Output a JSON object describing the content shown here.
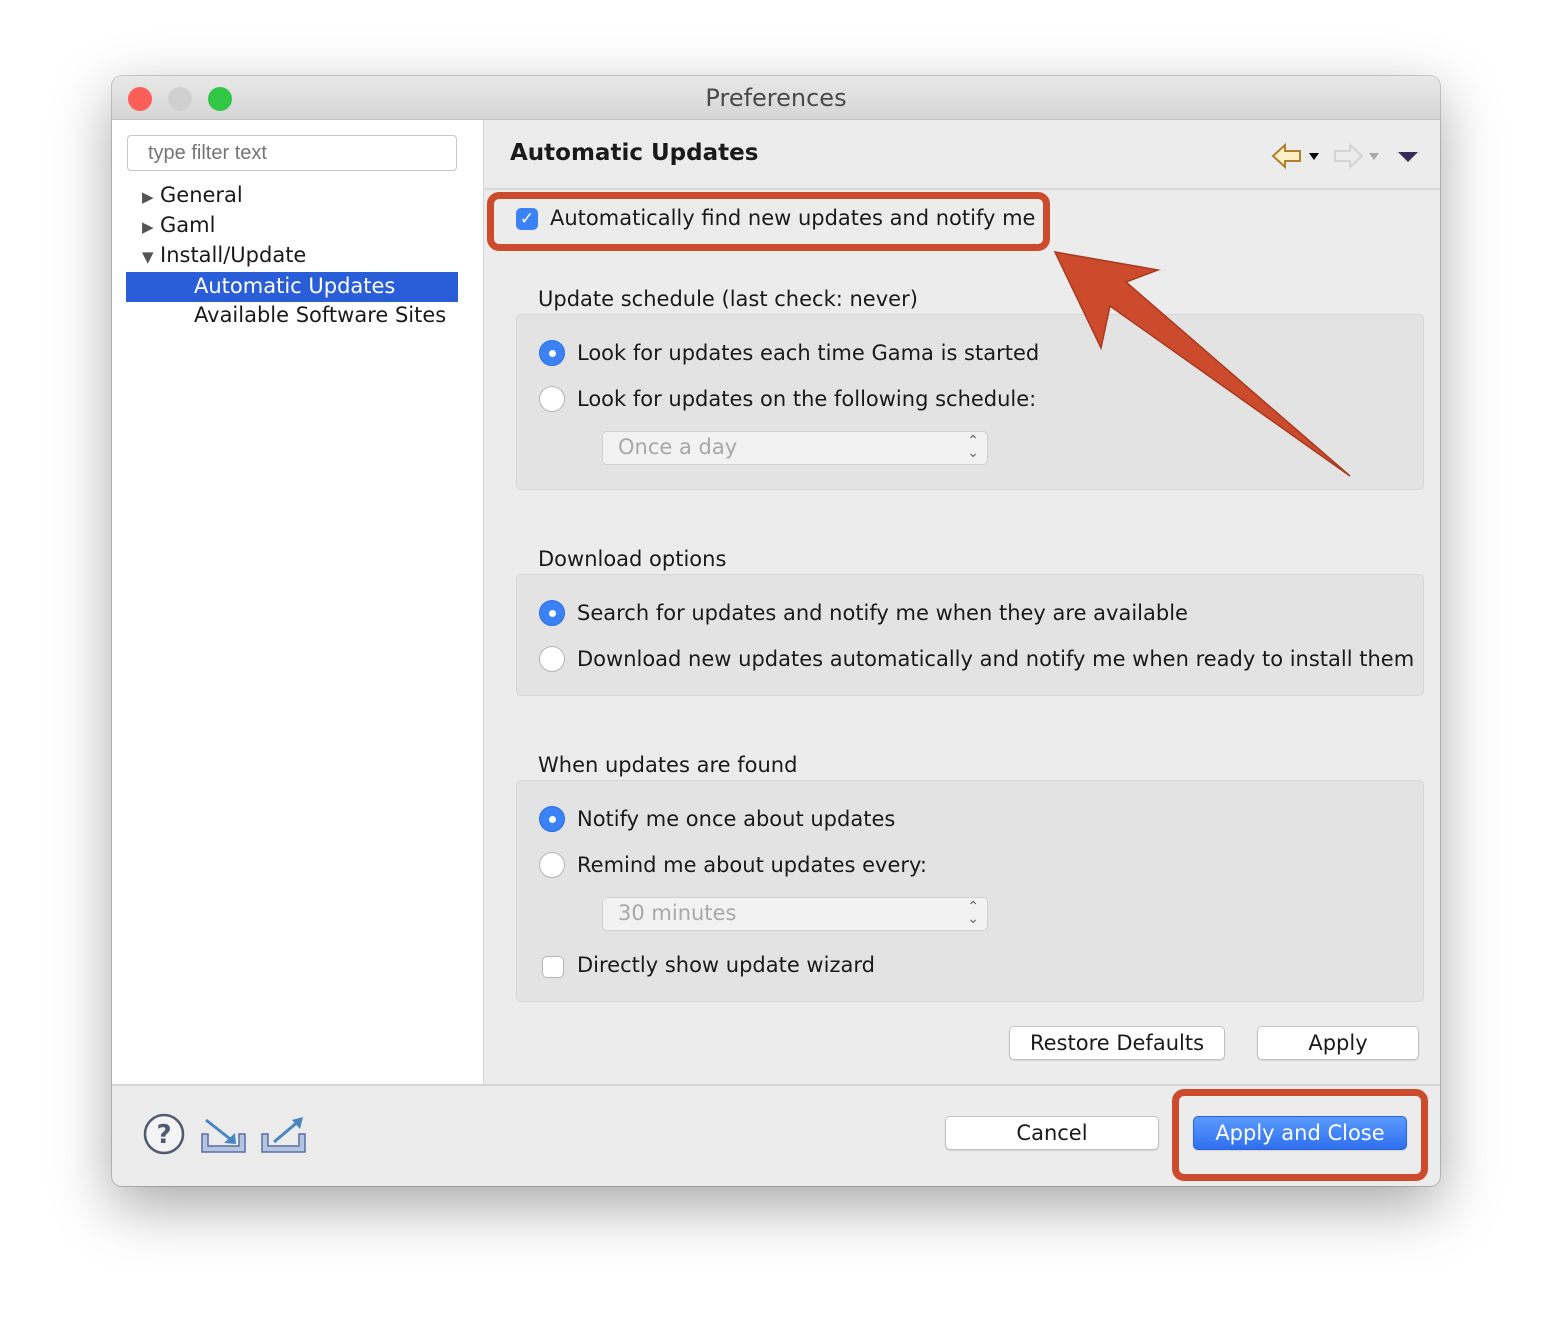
{
  "window": {
    "title": "Preferences",
    "traffic_colors": [
      "#fc5f57",
      "#d0d0d0",
      "#33c748"
    ]
  },
  "sidebar": {
    "filter_placeholder": "type filter text",
    "items": [
      {
        "label": "General",
        "expanded": false
      },
      {
        "label": "Gaml",
        "expanded": false
      },
      {
        "label": "Install/Update",
        "expanded": true
      },
      {
        "label": "Automatic Updates",
        "selected": true
      },
      {
        "label": "Available Software Sites"
      }
    ]
  },
  "page": {
    "title": "Automatic Updates",
    "auto_find": {
      "label": "Automatically find new updates and notify me",
      "checked": true
    },
    "schedule": {
      "heading": "Update schedule (last check: never)",
      "options": [
        "Look for updates each time Gama is started",
        "Look for updates on the following schedule:"
      ],
      "selected": 0,
      "interval": "Once a day"
    },
    "download": {
      "heading": "Download options",
      "options": [
        "Search for updates and notify me when they are available",
        "Download new updates automatically and notify me when ready to install them"
      ],
      "selected": 0
    },
    "found": {
      "heading": "When updates are found",
      "options": [
        "Notify me once about updates",
        "Remind me about updates every:"
      ],
      "selected": 0,
      "interval": "30 minutes",
      "wizard": {
        "label": "Directly show update wizard",
        "checked": false
      }
    },
    "restore_label": "Restore Defaults",
    "apply_label": "Apply"
  },
  "footer": {
    "cancel_label": "Cancel",
    "apply_close_label": "Apply and Close"
  },
  "colors": {
    "accent": "#2a5ed8",
    "highlight": "#cc4b2c"
  }
}
